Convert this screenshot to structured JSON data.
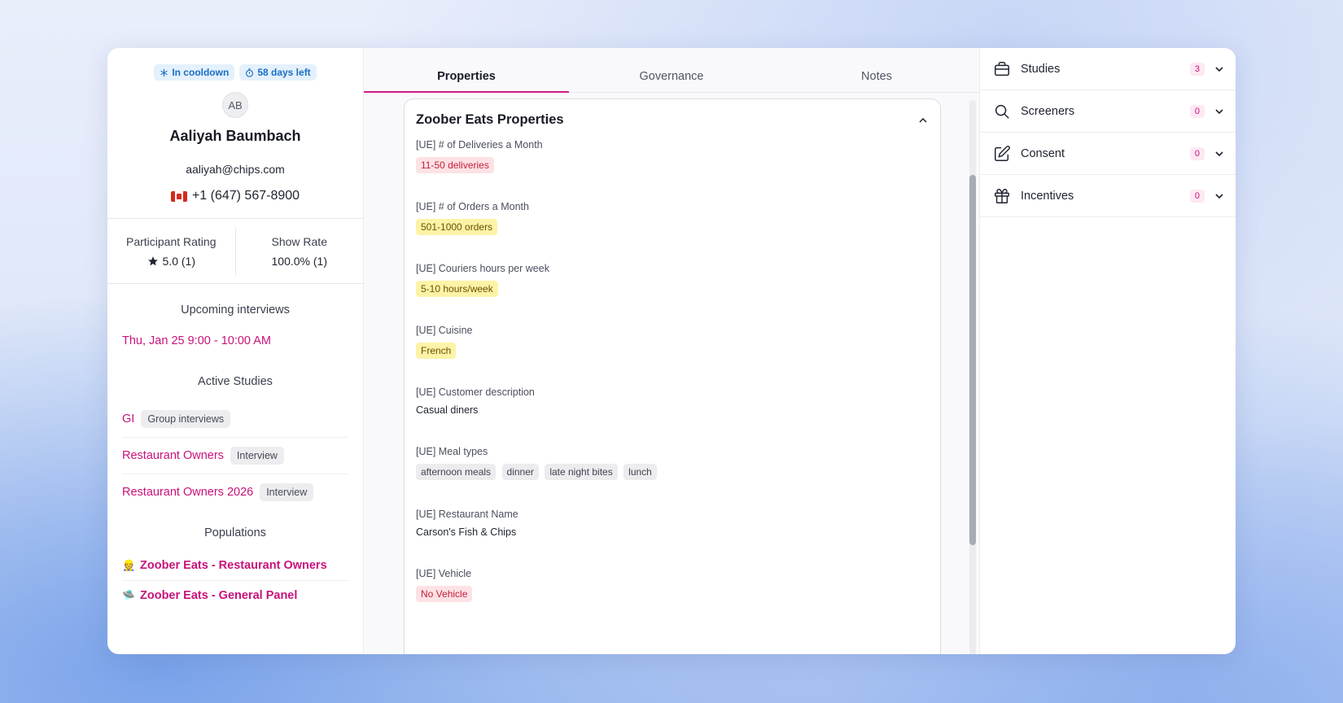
{
  "profile": {
    "badges": {
      "cooldown": "In cooldown",
      "days_left": "58 days left"
    },
    "initials": "AB",
    "name": "Aaliyah Baumbach",
    "email": "aaliyah@chips.com",
    "phone": "+1 (647) 567-8900",
    "flag_icon": "canada-flag-icon"
  },
  "stats": {
    "rating_label": "Participant Rating",
    "rating_value": "5.0 (1)",
    "show_label": "Show Rate",
    "show_value": "100.0% (1)"
  },
  "upcoming": {
    "title": "Upcoming interviews",
    "item": "Thu, Jan 25 9:00 - 10:00 AM"
  },
  "active_studies": {
    "title": "Active Studies",
    "items": [
      {
        "name": "GI",
        "type": "Group interviews"
      },
      {
        "name": "Restaurant Owners",
        "type": "Interview"
      },
      {
        "name": "Restaurant Owners 2026",
        "type": "Interview"
      }
    ]
  },
  "populations": {
    "title": "Populations",
    "items": [
      {
        "emoji": "👷",
        "name": "Zoober Eats - Restaurant Owners"
      },
      {
        "emoji": "🛸",
        "name": "Zoober Eats - General Panel"
      }
    ]
  },
  "tabs": [
    "Properties",
    "Governance",
    "Notes"
  ],
  "properties": {
    "title": "Zoober Eats Properties",
    "items": [
      {
        "label": "[UE] # of Deliveries a Month",
        "tags": [
          {
            "text": "11-50 deliveries",
            "color": "red"
          }
        ]
      },
      {
        "label": "[UE] # of Orders a Month",
        "tags": [
          {
            "text": "501-1000 orders",
            "color": "yellow"
          }
        ]
      },
      {
        "label": "[UE] Couriers hours per week",
        "tags": [
          {
            "text": "5-10 hours/week",
            "color": "yellow"
          }
        ]
      },
      {
        "label": "[UE] Cuisine",
        "tags": [
          {
            "text": "French",
            "color": "yellow"
          }
        ]
      },
      {
        "label": "[UE] Customer description",
        "text": "Casual diners"
      },
      {
        "label": "[UE] Meal types",
        "tags": [
          {
            "text": "afternoon meals",
            "color": "gray"
          },
          {
            "text": "dinner",
            "color": "gray"
          },
          {
            "text": "late night bites",
            "color": "gray"
          },
          {
            "text": "lunch",
            "color": "gray"
          }
        ]
      },
      {
        "label": "[UE] Restaurant Name",
        "text": "Carson's Fish & Chips"
      },
      {
        "label": "[UE] Vehicle",
        "tags": [
          {
            "text": "No Vehicle",
            "color": "red"
          }
        ]
      }
    ]
  },
  "sidebar": {
    "items": [
      {
        "label": "Studies",
        "count": "3",
        "icon": "briefcase-icon"
      },
      {
        "label": "Screeners",
        "count": "0",
        "icon": "search-icon"
      },
      {
        "label": "Consent",
        "count": "0",
        "icon": "edit-icon"
      },
      {
        "label": "Incentives",
        "count": "0",
        "icon": "gift-icon"
      }
    ]
  },
  "colors": {
    "accent": "#c8127b",
    "tab_underline": "#d21a85",
    "badge_blue": "#1a6fc4"
  }
}
